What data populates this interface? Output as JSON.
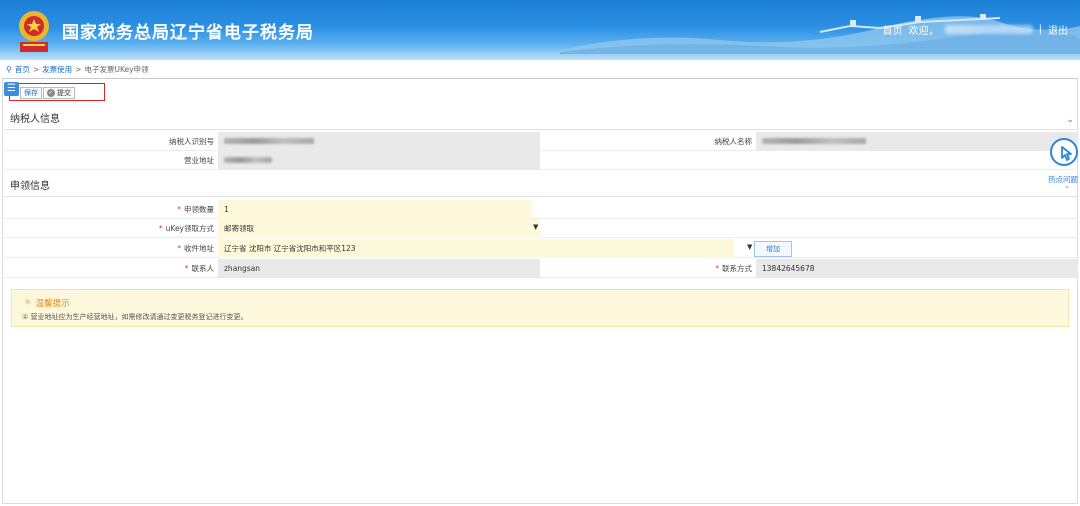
{
  "header": {
    "site_title": "国家税务总局辽宁省电子税务局",
    "home_link": "首页",
    "welcome": "欢迎，",
    "separator": "|",
    "logout": "退出",
    "brand_color": "#1c7fd6"
  },
  "breadcrumb": {
    "items": [
      "首页",
      "发票使用",
      "电子发票UKey申领"
    ],
    "sep": ">"
  },
  "toolbar": {
    "save_label": "保存",
    "submit_label": "提交"
  },
  "taxpayer_section": {
    "title": "纳税人信息",
    "tax_id_label": "纳税人识别号",
    "name_label": "纳税人名称",
    "address_label": "营业地址"
  },
  "apply_section": {
    "title": "申领信息",
    "quantity_label": "申领数量",
    "quantity_value": "1",
    "method_label": "uKey领取方式",
    "method_value": "邮寄领取",
    "address_label": "收件地址",
    "address_value": "辽宁省  沈阳市  辽宁省沈阳市和平区123",
    "add_label": "增加",
    "contact_label": "联系人",
    "contact_value": "zhangsan",
    "phone_label": "联系方式",
    "phone_value": "13842645678",
    "required_mark": "*"
  },
  "tip": {
    "title": "温馨提示",
    "text": "① 营业地址应为生产经营地址，如需修改请通过变更税务登记进行变更。"
  },
  "hot_questions": {
    "label": "热点问题"
  }
}
